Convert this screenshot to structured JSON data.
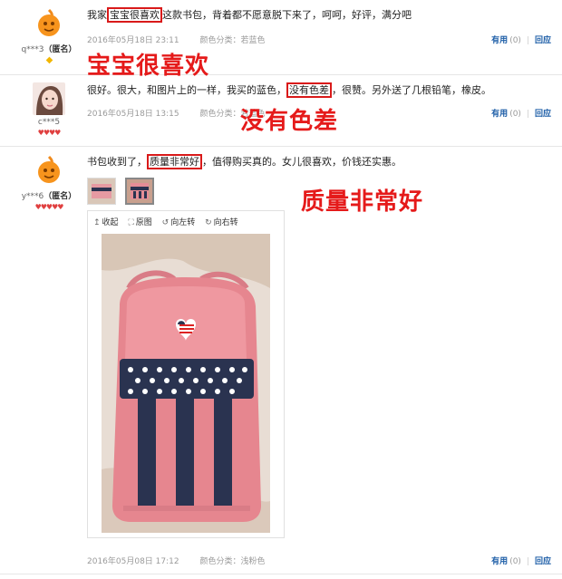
{
  "reviews": [
    {
      "username": "q***3",
      "anon": "（匿名）",
      "text_before": "我家",
      "highlight": "宝宝很喜欢",
      "text_after": "这款书包，背着都不愿意脱下来了，呵呵，好评，满分吧",
      "date": "2016年05月18日 23:11",
      "category_label": "颜色分类：",
      "category_value": "若蓝色",
      "annotation": "宝宝很喜欢",
      "rank_glyph": "◆"
    },
    {
      "username": "c***5",
      "anon": "",
      "text_before": "很好。很大，和图片上的一样，我买的蓝色，",
      "highlight": "没有色差",
      "text_after": "，很赞。另外送了几根铅笔，橡皮。",
      "date": "2016年05月18日 13:15",
      "category_label": "颜色分类：",
      "category_value": "若蓝色",
      "annotation": "没有色差",
      "rank_glyph": "♥♥♥♥"
    },
    {
      "username": "y***6",
      "anon": "（匿名）",
      "text_before": "书包收到了，",
      "highlight": "质量非常好",
      "text_after": "，值得购买真的。女儿很喜欢，价钱还实惠。",
      "date": "2016年05月08日 17:12",
      "category_label": "颜色分类：",
      "category_value": "浅粉色",
      "annotation": "质量非常好",
      "rank_glyph": "♥♥♥♥♥"
    }
  ],
  "actions": {
    "useful": "有用",
    "count": "(0)",
    "reply": "回应"
  },
  "viewer": {
    "collapse": "收起",
    "original": "原图",
    "rotate_left": "向左转",
    "rotate_right": "向右转"
  },
  "colors": {
    "accent_red": "#e51a1a",
    "link_blue": "#1f5fa8",
    "bag_pink": "#e7878f",
    "bag_navy": "#2a3350"
  }
}
